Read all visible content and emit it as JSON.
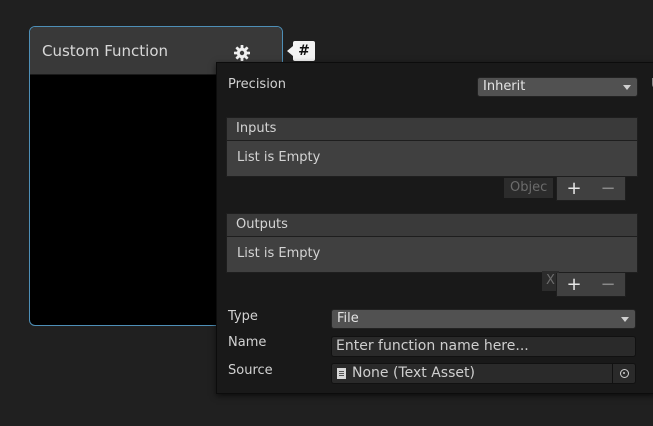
{
  "node": {
    "title": "Custom Function",
    "badge": "#",
    "gear_icon": "gear-icon"
  },
  "background": {
    "chip_object": "Objec",
    "chip_x": "X",
    "panel_edge_letter": "U"
  },
  "panel": {
    "precision": {
      "label": "Precision",
      "value": "Inherit"
    },
    "inputs": {
      "header": "Inputs",
      "empty_text": "List is Empty",
      "add": "+",
      "remove": "−"
    },
    "outputs": {
      "header": "Outputs",
      "empty_text": "List is Empty",
      "add": "+",
      "remove": "−"
    },
    "type": {
      "label": "Type",
      "value": "File"
    },
    "name": {
      "label": "Name",
      "placeholder": "Enter function name here..."
    },
    "source": {
      "label": "Source",
      "value": "None (Text Asset)"
    }
  },
  "colors": {
    "node_border": "#4e8fb7",
    "port_yellow": "#e5d545",
    "port_teal": "#7fd6e0"
  }
}
